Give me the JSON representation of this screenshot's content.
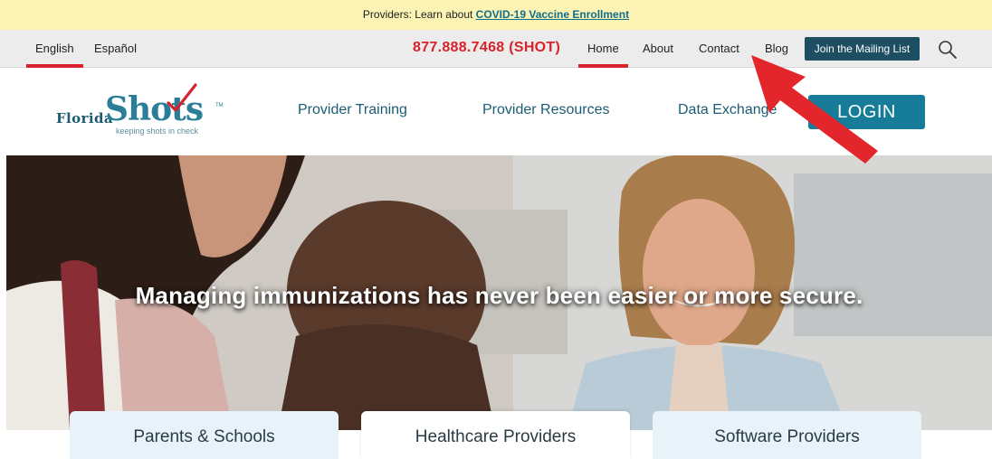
{
  "announcement": {
    "prefix": "Providers: Learn about",
    "link": "COVID-19 Vaccine Enrollment"
  },
  "utility_nav": {
    "languages": [
      "English",
      "Español"
    ],
    "active_language": "English",
    "phone": "877.888.7468 (SHOT)",
    "links": [
      "Home",
      "About",
      "Contact",
      "Blog"
    ],
    "active_link": "Home",
    "mailing_button": "Join the Mailing List",
    "search_icon": "search-icon"
  },
  "header": {
    "logo": {
      "word1": "Florida",
      "word2": "Shots",
      "trademark": "TM",
      "tagline": "keeping shots in check"
    },
    "nav": [
      "Provider Training",
      "Provider Resources",
      "Data Exchange"
    ],
    "login_label": "LOGIN"
  },
  "hero": {
    "headline": "Managing immunizations has never been easier or more secure."
  },
  "tabs": [
    {
      "label": "Parents & Schools",
      "active": false
    },
    {
      "label": "Healthcare Providers",
      "active": true
    },
    {
      "label": "Software Providers",
      "active": false
    }
  ],
  "colors": {
    "announce_bg": "#fbf3b4",
    "accent_red": "#d8222c",
    "brand_teal": "#177c97",
    "mailing_bg": "#1d4e61"
  }
}
